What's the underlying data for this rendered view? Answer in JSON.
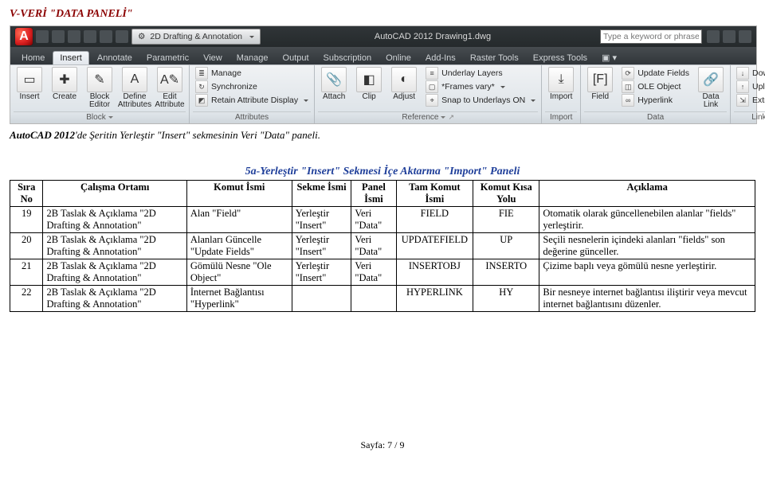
{
  "doc_title": "V-VERİ \"DATA PANELİ\"",
  "caption_prefix_italic": "AutoCAD 2012",
  "caption_rest": "'de Şeritin Yerleştir \"Insert\" sekmesinin Veri \"Data\" paneli.",
  "ribbon": {
    "app_title": "AutoCAD 2012   Drawing1.dwg",
    "qat_mode": "2D Drafting & Annotation",
    "search_placeholder": "Type a keyword or phrase",
    "tabs": [
      "Home",
      "Insert",
      "Annotate",
      "Parametric",
      "View",
      "Manage",
      "Output",
      "Subscription",
      "Online",
      "Add-Ins",
      "Raster Tools",
      "Express Tools"
    ],
    "active_tab": "Insert",
    "panels": {
      "block": {
        "title": "Block",
        "items": [
          "Insert",
          "Create",
          "Block Editor",
          "Define Attributes",
          "Edit Attribute"
        ]
      },
      "attributes": {
        "title": "Attributes",
        "items": [
          "Manage",
          "Synchronize",
          "Retain Attribute Display"
        ]
      },
      "reference": {
        "title": "Reference",
        "items": [
          "Attach",
          "Clip",
          "Adjust",
          "Underlay Layers",
          "*Frames vary*",
          "Snap to Underlays ON"
        ]
      },
      "import": {
        "title": "Import",
        "items": [
          "Import"
        ]
      },
      "data": {
        "title": "Data",
        "items": [
          "Field",
          "Update Fields",
          "OLE Object",
          "Hyperlink",
          "Data Link"
        ]
      },
      "linking": {
        "title": "Linking & Extraction",
        "items": [
          "Download from Source",
          "Upload to Source",
          "Extract Data"
        ]
      }
    }
  },
  "table": {
    "title": "5a-Yerleştir \"Insert\" Sekmesi İçe Aktarma \"Import\" Paneli",
    "headers": [
      "Sıra No",
      "Çalışma Ortamı",
      "Komut İsmi",
      "Sekme İsmi",
      "Panel İsmi",
      "Tam Komut İsmi",
      "Komut Kısa Yolu",
      "Açıklama"
    ],
    "rows": [
      {
        "no": "19",
        "ortam": "2B Taslak & Açıklama \"2D Drafting & Annotation\"",
        "komut": "Alan \"Field\"",
        "sekme": "Yerleştir \"Insert\"",
        "panel": "Veri \"Data\"",
        "tam": "FIELD",
        "kisa": "FIE",
        "aciklama": "Otomatik olarak güncellenebilen alanlar \"fields\" yerleştirir."
      },
      {
        "no": "20",
        "ortam": "2B Taslak & Açıklama \"2D Drafting & Annotation\"",
        "komut": "Alanları Güncelle \"Update Fields\"",
        "sekme": "Yerleştir \"Insert\"",
        "panel": "Veri \"Data\"",
        "tam": "UPDATEFIELD",
        "kisa": "UP",
        "aciklama": "Seçili nesnelerin içindeki alanları \"fields\" son değerine günceller."
      },
      {
        "no": "21",
        "ortam": "2B Taslak & Açıklama \"2D Drafting & Annotation\"",
        "komut": "Gömülü Nesne \"Ole Object\"",
        "sekme": "Yerleştir \"Insert\"",
        "panel": "Veri \"Data\"",
        "tam": "INSERTOBJ",
        "kisa": "INSERTO",
        "aciklama": "Çizime baplı veya gömülü nesne yerleştirir."
      },
      {
        "no": "22",
        "ortam": "2B Taslak & Açıklama \"2D Drafting & Annotation\"",
        "komut": "İnternet Bağlantısı \"Hyperlink\"",
        "sekme": "",
        "panel": "",
        "tam": "HYPERLINK",
        "kisa": "HY",
        "aciklama": "Bir nesneye internet bağlantısı iliştirir veya mevcut internet bağlantısını düzenler."
      }
    ]
  },
  "footer": "Sayfa: 7 / 9"
}
